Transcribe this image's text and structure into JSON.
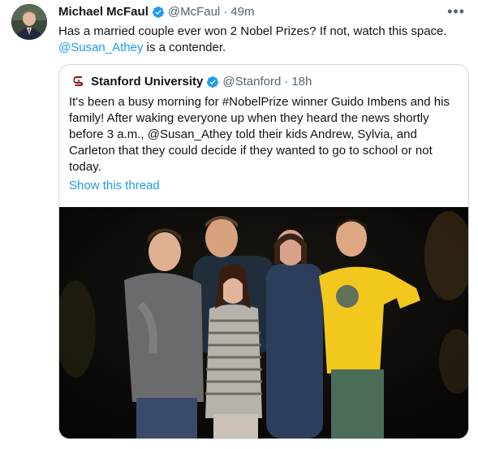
{
  "tweet": {
    "author_name": "Michael McFaul",
    "handle": "@McFaul",
    "separator": "·",
    "time": "49m",
    "text_line1": "Has a married couple ever won 2 Nobel Prizes? If not, watch this space.",
    "mention": "@Susan_Athey",
    "text_after_mention": " is a contender.",
    "more_icon": "more-horizontal-icon"
  },
  "quote": {
    "author_name": "Stanford University",
    "handle": "@Stanford",
    "separator": "·",
    "time": "18h",
    "text": "It's been a busy morning for #NobelPrize winner Guido Imbens and his family! After waking everyone up when they heard the news shortly before 3 a.m., @Susan_Athey told their kids Andrew, Sylvia, and Carleton that they could decide if they wanted to go to school or not today.",
    "show_thread": "Show this thread"
  },
  "colors": {
    "link": "#1d9bf0",
    "verified": "#1d9bf0",
    "secondary_text": "#536471",
    "border": "#cfd9de"
  }
}
